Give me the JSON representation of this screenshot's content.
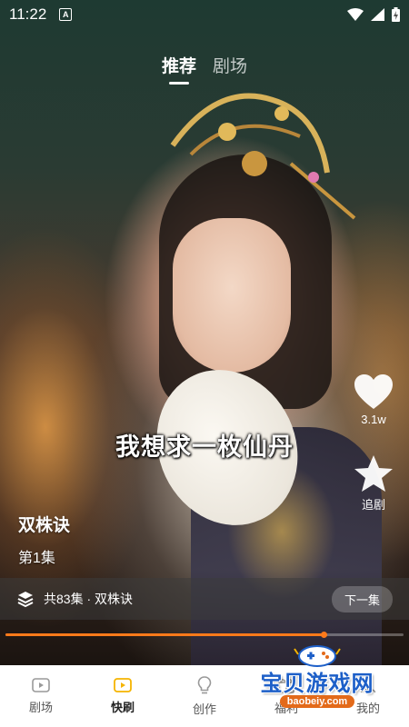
{
  "status_bar": {
    "time": "11:22",
    "notification_icon": "A",
    "icons": [
      "wifi-icon",
      "signal-icon",
      "battery-icon"
    ]
  },
  "top_tabs": [
    {
      "label": "推荐",
      "active": true
    },
    {
      "label": "剧场",
      "active": false
    }
  ],
  "side_actions": {
    "like_count": "3.1w",
    "follow_label": "追剧"
  },
  "subtitle": "我想求一枚仙丹",
  "drama": {
    "title": "双株诀",
    "episode": "第1集"
  },
  "series_bar": {
    "text": "共83集 · 双株诀",
    "next_label": "下一集"
  },
  "playback": {
    "progress": 0.8
  },
  "bottom_nav": [
    {
      "label": "剧场",
      "icon": "theater-icon",
      "active": false
    },
    {
      "label": "快刷",
      "icon": "quick-play-icon",
      "active": true
    },
    {
      "label": "创作",
      "icon": "create-bulb-icon",
      "active": false
    },
    {
      "label": "福利",
      "icon": "gift-icon",
      "active": false
    },
    {
      "label": "我的",
      "icon": "profile-icon",
      "active": false
    }
  ],
  "watermark": {
    "text": "宝贝游戏网",
    "url": "baobeiy.com"
  },
  "colors": {
    "accent": "#ff7a1a",
    "active_nav": "#f5b400",
    "watermark_blue": "#1d5fc8"
  }
}
